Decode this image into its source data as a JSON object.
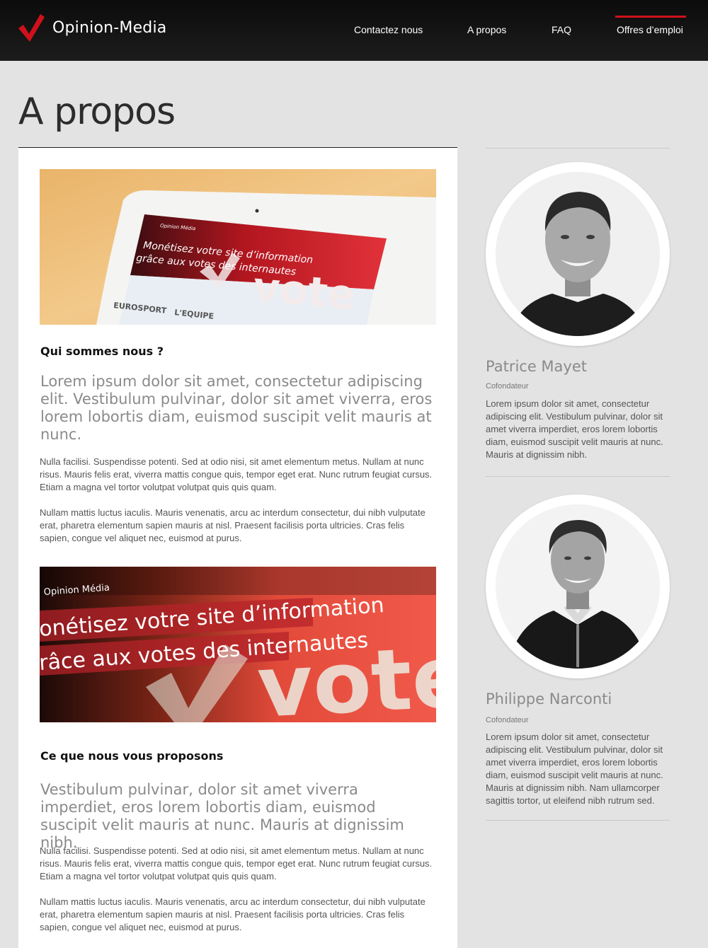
{
  "header": {
    "brand": "Opinion-Media",
    "nav": [
      {
        "label": "Contactez nous"
      },
      {
        "label": "A propos"
      },
      {
        "label": "FAQ"
      },
      {
        "label": "Offres d’emploi",
        "active": true
      }
    ],
    "accent_color": "#d0111b"
  },
  "page": {
    "title": "A propos"
  },
  "main": {
    "images": [
      {
        "icon": "tablet-photo",
        "screen_brand": "Opinion Média",
        "screen_headline_1": "Monétisez votre site d’information",
        "screen_headline_2": "grâce aux votes des internautes",
        "screen_word": "vote",
        "logos": [
          "EUROSPORT",
          "L'EQUIPE"
        ]
      },
      {
        "icon": "screen-closeup-photo",
        "screen_brand": "Opinion Média",
        "screen_headline_1": "onétisez votre site d’information",
        "screen_headline_2": "râce aux votes des internautes",
        "screen_word": "vote"
      }
    ],
    "sections": [
      {
        "heading": "Qui sommes nous ?",
        "lead": "Lorem ipsum dolor sit amet, consectetur adipiscing elit. Vestibulum pulvinar, dolor sit amet viverra, eros lorem lobortis diam, euismod suscipit velit mauris at nunc.",
        "paragraphs": [
          "Nulla facilisi. Suspendisse potenti. Sed at odio nisi, sit amet elementum metus. Nullam at nunc risus. Mauris felis erat, viverra mattis congue quis, tempor eget erat. Nunc rutrum feugiat cursus. Etiam a magna vel tortor volutpat volutpat quis quis quam.",
          "Nullam mattis luctus iaculis. Mauris venenatis, arcu ac interdum consectetur, dui nibh vulputate erat, pharetra elementum sapien mauris at nisl. Praesent facilisis porta ultricies. Cras felis sapien, congue vel aliquet nec, euismod at purus."
        ]
      },
      {
        "heading": "Ce que nous vous proposons",
        "lead": "Vestibulum pulvinar, dolor sit amet viverra imperdiet, eros lorem lobortis diam, euismod suscipit velit mauris at nunc. Mauris at dignissim nibh.",
        "paragraphs": [
          "Nulla facilisi. Suspendisse potenti. Sed at odio nisi, sit amet elementum metus. Nullam at nunc risus. Mauris felis erat, viverra mattis congue quis, tempor eget erat. Nunc rutrum feugiat cursus. Etiam a magna vel tortor volutpat volutpat quis quis quam.",
          "Nullam mattis luctus iaculis. Mauris venenatis, arcu ac interdum consectetur, dui nibh vulputate erat, pharetra elementum sapien mauris at nisl. Praesent facilisis porta ultricies. Cras felis sapien, congue vel aliquet nec, euismod at purus."
        ]
      }
    ]
  },
  "team": [
    {
      "name": "Patrice Mayet",
      "role": "Cofondateur",
      "bio": "Lorem ipsum dolor sit amet, consectetur adipiscing elit. Vestibulum pulvinar, dolor sit amet viverra imperdiet, eros lorem lobortis diam, euismod suscipit velit mauris at nunc. Mauris at dignissim nibh.",
      "icon": "portrait-photo"
    },
    {
      "name": "Philippe Narconti",
      "role": "Cofondateur",
      "bio": "Lorem ipsum dolor sit amet, consectetur adipiscing elit. Vestibulum pulvinar, dolor sit amet viverra imperdiet, eros lorem lobortis diam, euismod suscipit velit mauris at nunc. Mauris at dignissim nibh. Nam ullamcorper sagittis tortor, ut eleifend nibh rutrum sed.",
      "icon": "portrait-photo"
    }
  ]
}
